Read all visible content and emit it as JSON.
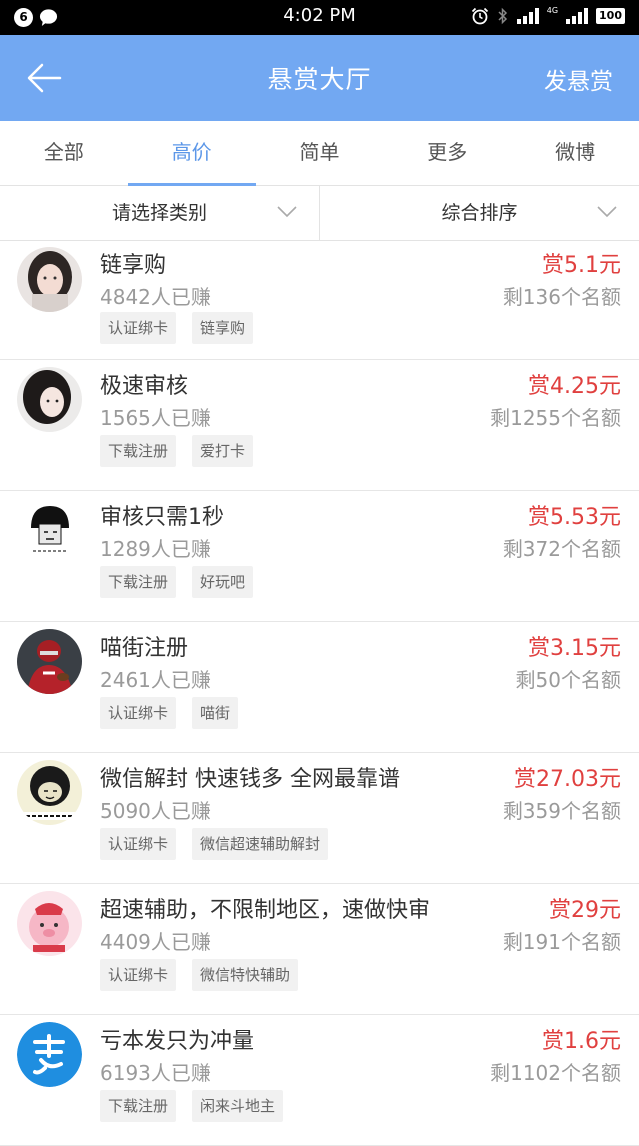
{
  "status_bar": {
    "notification_count": "6",
    "time": "4:02 PM",
    "network": "4G",
    "battery": "100"
  },
  "header": {
    "title": "悬赏大厅",
    "post_label": "发悬赏",
    "back_icon": "arrow-left-icon",
    "background": "#72a8f2"
  },
  "tabs": [
    {
      "label": "全部",
      "active": false
    },
    {
      "label": "高价",
      "active": true
    },
    {
      "label": "简单",
      "active": false
    },
    {
      "label": "更多",
      "active": false
    },
    {
      "label": "微博",
      "active": false
    }
  ],
  "filters": {
    "category": "请选择类别",
    "sort": "综合排序"
  },
  "colors": {
    "reward": "#e0403f",
    "accent": "#72a8f2"
  },
  "items": [
    {
      "title": "链享购",
      "earned": "4842人已赚",
      "tags": [
        "认证绑卡",
        "链享购"
      ],
      "reward": "赏5.1元",
      "remaining": "剩136个名额",
      "avatar": "girl-portrait"
    },
    {
      "title": "极速审核",
      "earned": "1565人已赚",
      "tags": [
        "下载注册",
        "爱打卡"
      ],
      "reward": "赏4.25元",
      "remaining": "剩1255个名额",
      "avatar": "woman-portrait"
    },
    {
      "title": "审核只需1秒",
      "earned": "1289人已赚",
      "tags": [
        "下载注册",
        "好玩吧"
      ],
      "reward": "赏5.53元",
      "remaining": "剩372个名额",
      "avatar": "meme-cartoon"
    },
    {
      "title": "喵街注册",
      "earned": "2461人已赚",
      "tags": [
        "认证绑卡",
        "喵街"
      ],
      "reward": "赏3.15元",
      "remaining": "剩50个名额",
      "avatar": "football-player"
    },
    {
      "title": "微信解封 快速钱多 全网最靠谱",
      "earned": "5090人已赚",
      "tags": [
        "认证绑卡",
        "微信超速辅助解封"
      ],
      "reward": "赏27.03元",
      "remaining": "剩359个名额",
      "avatar": "meme-face"
    },
    {
      "title": "超速辅助，不限制地区，速做快审",
      "earned": "4409人已赚",
      "tags": [
        "认证绑卡",
        "微信特快辅助"
      ],
      "reward": "赏29元",
      "remaining": "剩191个名额",
      "avatar": "pink-cartoon"
    },
    {
      "title": "亏本发只为冲量",
      "earned": "6193人已赚",
      "tags": [
        "下载注册",
        "闲来斗地主"
      ],
      "reward": "赏1.6元",
      "remaining": "剩1102个名额",
      "avatar": "blue-logo"
    }
  ]
}
